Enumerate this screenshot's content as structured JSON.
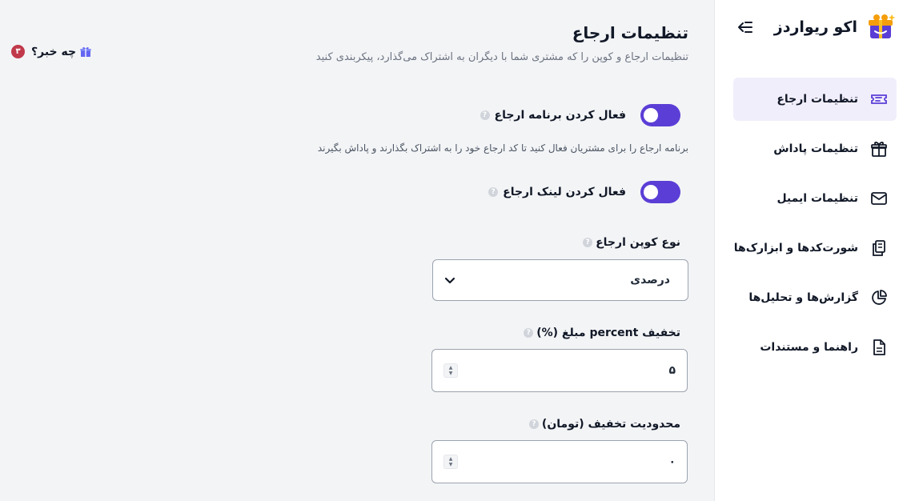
{
  "brand": {
    "name": "اکو ریواردز"
  },
  "nav": {
    "items": [
      {
        "label": "تنظیمات ارجاع",
        "icon": "ticket-icon",
        "active": true
      },
      {
        "label": "تنظیمات پاداش",
        "icon": "gift-icon"
      },
      {
        "label": "تنظیمات ایمیل",
        "icon": "mail-icon"
      },
      {
        "label": "شورت‌کدها و ابزارک‌ها",
        "icon": "clipboard-icon"
      },
      {
        "label": "گزارش‌ها و تحلیل‌ها",
        "icon": "pie-chart-icon"
      },
      {
        "label": "راهنما و مستندات",
        "icon": "document-icon"
      }
    ]
  },
  "header": {
    "title": "تنظیمات ارجاع",
    "subtitle": "تنظیمات ارجاع و کوپن را که مشتری شما با دیگران به اشتراک می‌گذارد، پیکربندی کنید"
  },
  "whatsnew": {
    "label": "چه خبر؟",
    "count": "۳"
  },
  "settings": {
    "enable_program": {
      "label": "فعال کردن برنامه ارجاع",
      "on": true
    },
    "program_desc": "برنامه ارجاع را برای مشتریان فعال کنید تا کد ارجاع خود را به اشتراک بگذارند و پاداش بگیرند",
    "enable_link": {
      "label": "فعال کردن لینک ارجاع",
      "on": true
    },
    "coupon_type": {
      "label": "نوع کوپن ارجاع",
      "value": "درصدی"
    },
    "discount": {
      "label": "تخفیف percent مبلغ (%)",
      "value": "۵"
    },
    "limit": {
      "label": "محدودیت تخفیف (تومان)",
      "value": "۰"
    }
  },
  "colors": {
    "accent": "#5b3ed6",
    "active_bg": "#f1eefc",
    "badge": "#c0394a"
  }
}
